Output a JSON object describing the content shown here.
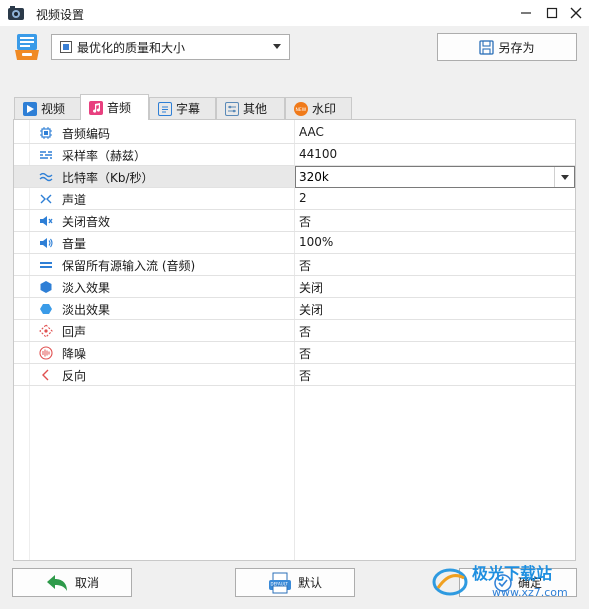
{
  "window": {
    "title": "视频设置"
  },
  "preset": {
    "value": "最优化的质量和大小",
    "saveas_label": "另存为"
  },
  "tabs": [
    {
      "label": "视频",
      "icon": "video-tab-icon",
      "active": false
    },
    {
      "label": "音频",
      "icon": "music-note-icon",
      "active": true
    },
    {
      "label": "字幕",
      "icon": "subtitle-icon",
      "active": false
    },
    {
      "label": "其他",
      "icon": "settings-sliders-icon",
      "active": false
    },
    {
      "label": "水印",
      "icon": "new-badge-icon",
      "active": false
    }
  ],
  "audio_settings": [
    {
      "name": "音频编码",
      "value": "AAC",
      "icon": "chip-icon"
    },
    {
      "name": "采样率（赫兹）",
      "value": "44100",
      "icon": "sample-rate-icon"
    },
    {
      "name": "比特率（Kb/秒）",
      "value": "320k",
      "icon": "wave-icon"
    },
    {
      "name": "声道",
      "value": "2",
      "icon": "channels-icon"
    },
    {
      "name": "关闭音效",
      "value": "否",
      "icon": "mute-icon"
    },
    {
      "name": "音量",
      "value": "100%",
      "icon": "volume-icon"
    },
    {
      "name": "保留所有源输入流 (音频)",
      "value": "否",
      "icon": "equal-lines-icon"
    },
    {
      "name": "淡入效果",
      "value": "关闭",
      "icon": "fade-in-icon"
    },
    {
      "name": "淡出效果",
      "value": "关闭",
      "icon": "fade-out-icon"
    },
    {
      "name": "回声",
      "value": "否",
      "icon": "echo-icon"
    },
    {
      "name": "降噪",
      "value": "否",
      "icon": "denoise-icon"
    },
    {
      "name": "反向",
      "value": "否",
      "icon": "reverse-icon"
    }
  ],
  "buttons": {
    "cancel": "取消",
    "default": "默认",
    "default_icon_text": "DEFAULT",
    "ok": "确定"
  },
  "watermark": {
    "text": "极光下载站",
    "url": "www.xz7.com"
  },
  "colors": {
    "accent_blue": "#1e8fe0",
    "pink_tab": "#e8407f",
    "orange_badge": "#f07a1a",
    "green_arrow": "#2e9a4a"
  }
}
